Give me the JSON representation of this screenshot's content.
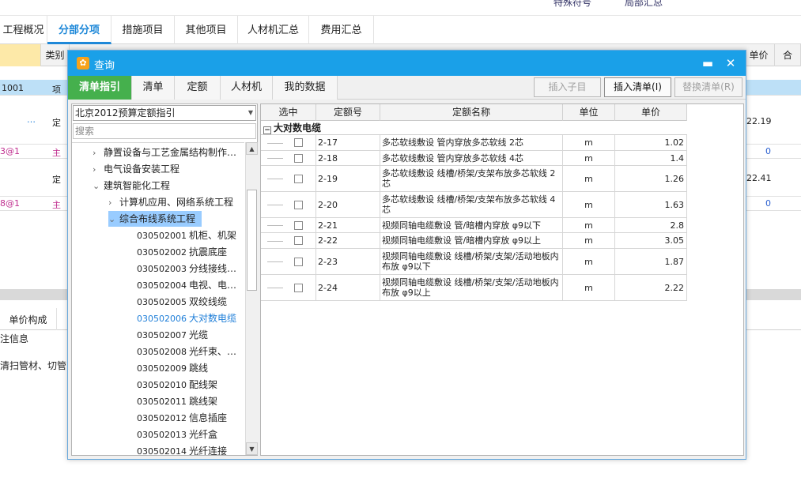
{
  "app": {
    "top_tools": [
      "特殊符号",
      "局部汇总"
    ],
    "tabs": [
      "工程概况",
      "分部分项",
      "措施项目",
      "其他项目",
      "人材机汇总",
      "费用汇总"
    ],
    "active_tab": "分部分项",
    "grid_headers": {
      "type_col": "类别",
      "price_col": "单价",
      "total_col": "合"
    },
    "rows": [
      {
        "code": "1001",
        "type": "项",
        "price": ""
      },
      {
        "code": "…",
        "type": "定",
        "price": "22.19"
      },
      {
        "code": "3@1",
        "type": "主",
        "price": "0"
      },
      {
        "code": "",
        "type": "定",
        "price": "22.41"
      },
      {
        "code": "8@1",
        "type": "主",
        "price": "0"
      }
    ],
    "lower_tab": "单价构成",
    "lower_label": "注信息",
    "lower_text": "清扫管材、切管"
  },
  "dialog": {
    "title": "查询",
    "minimize_icon": "▬",
    "close_icon": "✕",
    "tabs": [
      "清单指引",
      "清单",
      "定额",
      "人材机",
      "我的数据"
    ],
    "active_tab": "清单指引",
    "buttons": {
      "insert_child": "插入子目",
      "insert_list": "插入清单(I)",
      "replace_list": "替换清单(R)"
    },
    "left": {
      "combo_value": "北京2012预算定额指引",
      "search_placeholder": "搜索",
      "tree": [
        {
          "label": "静置设备与工艺金属结构制作…",
          "chev": "›",
          "level": 0
        },
        {
          "label": "电气设备安装工程",
          "chev": "›",
          "level": 0
        },
        {
          "label": "建筑智能化工程",
          "chev": "⌄",
          "level": 0
        },
        {
          "label": "计算机应用、网络系统工程",
          "chev": "›",
          "level": 1
        },
        {
          "label": "综合布线系统工程",
          "chev": "⌄",
          "level": 1
        },
        {
          "code": "030502001",
          "label": "机柜、机架",
          "level": 2
        },
        {
          "code": "030502002",
          "label": "抗震底座",
          "level": 2
        },
        {
          "code": "030502003",
          "label": "分线接线…",
          "level": 2
        },
        {
          "code": "030502004",
          "label": "电视、电…",
          "level": 2
        },
        {
          "code": "030502005",
          "label": "双绞线缆",
          "level": 2
        },
        {
          "code": "030502006",
          "label": "大对数电缆",
          "level": 2
        },
        {
          "code": "030502007",
          "label": "光缆",
          "level": 2
        },
        {
          "code": "030502008",
          "label": "光纤束、…",
          "level": 2
        },
        {
          "code": "030502009",
          "label": "跳线",
          "level": 2
        },
        {
          "code": "030502010",
          "label": "配线架",
          "level": 2
        },
        {
          "code": "030502011",
          "label": "跳线架",
          "level": 2
        },
        {
          "code": "030502012",
          "label": "信息插座",
          "level": 2
        },
        {
          "code": "030502013",
          "label": "光纤盒",
          "level": 2
        },
        {
          "code": "030502014",
          "label": "光纤连接",
          "level": 2
        }
      ]
    },
    "right": {
      "headers": [
        "选中",
        "定额号",
        "定额名称",
        "单位",
        "单价"
      ],
      "group_toggle": "−",
      "group_label": "大对数电缆",
      "rows": [
        {
          "code": "2-17",
          "name": "多芯软线敷设 管内穿放多芯软线 2芯",
          "unit": "m",
          "price": "1.02"
        },
        {
          "code": "2-18",
          "name": "多芯软线敷设 管内穿放多芯软线 4芯",
          "unit": "m",
          "price": "1.4"
        },
        {
          "code": "2-19",
          "name": "多芯软线敷设 线槽/桥架/支架布放多芯软线 2芯",
          "unit": "m",
          "price": "1.26"
        },
        {
          "code": "2-20",
          "name": "多芯软线敷设 线槽/桥架/支架布放多芯软线 4芯",
          "unit": "m",
          "price": "1.63"
        },
        {
          "code": "2-21",
          "name": "视频同轴电缆敷设 管/暗槽内穿放 φ9以下",
          "unit": "m",
          "price": "2.8"
        },
        {
          "code": "2-22",
          "name": "视频同轴电缆敷设 管/暗槽内穿放 φ9以上",
          "unit": "m",
          "price": "3.05"
        },
        {
          "code": "2-23",
          "name": "视频同轴电缆敷设 线槽/桥架/支架/活动地板内布放 φ9以下",
          "unit": "m",
          "price": "1.87"
        },
        {
          "code": "2-24",
          "name": "视频同轴电缆敷设 线槽/桥架/支架/活动地板内布放 φ9以上",
          "unit": "m",
          "price": "2.22"
        }
      ]
    }
  }
}
